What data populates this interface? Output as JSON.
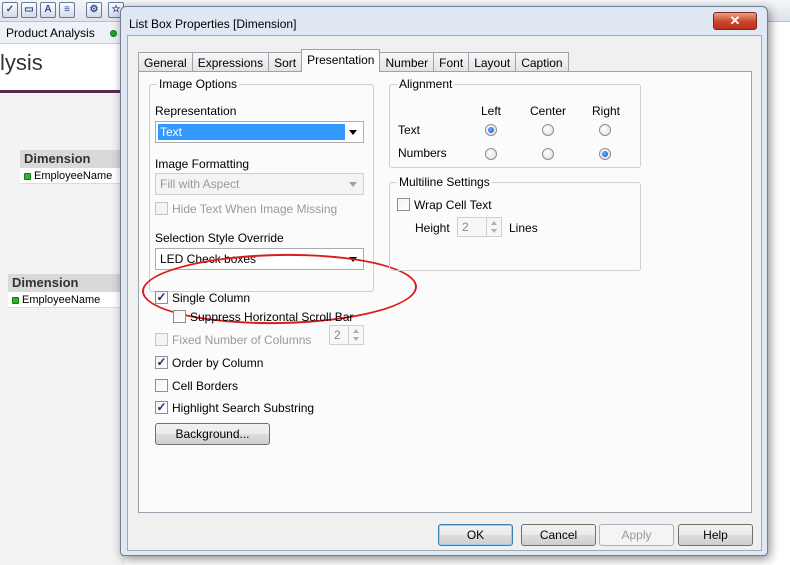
{
  "background_app": {
    "tab_label": "Product Analysis",
    "sheet_title": "lysis",
    "listbox_1": {
      "title": "Dimension",
      "item": "EmployeeName"
    },
    "listbox_2": {
      "title": "Dimension",
      "item": "EmployeeName"
    }
  },
  "dialog": {
    "title": "List Box Properties [Dimension]",
    "close_glyph": "✕",
    "tabs": [
      "General",
      "Expressions",
      "Sort",
      "Presentation",
      "Number",
      "Font",
      "Layout",
      "Caption"
    ],
    "active_tab": "Presentation"
  },
  "image_options": {
    "legend": "Image Options",
    "representation_label": "Representation",
    "representation_value": "Text",
    "image_formatting_label": "Image Formatting",
    "image_formatting_value": "Fill with Aspect",
    "hide_text_label": "Hide Text When Image Missing",
    "hide_text_checked": false,
    "selection_style_label": "Selection Style Override",
    "selection_style_value": "LED Check boxes"
  },
  "options": {
    "single_column": {
      "label": "Single Column",
      "checked": true
    },
    "suppress_scroll": {
      "label": "Suppress Horizontal Scroll Bar",
      "checked": false
    },
    "fixed_columns": {
      "label": "Fixed Number of Columns",
      "checked": false,
      "value": "2"
    },
    "order_by_column": {
      "label": "Order by Column",
      "checked": true
    },
    "cell_borders": {
      "label": "Cell Borders",
      "checked": false
    },
    "highlight_search": {
      "label": "Highlight Search Substring",
      "checked": true
    },
    "background_button": "Background..."
  },
  "alignment": {
    "legend": "Alignment",
    "columns": [
      "Left",
      "Center",
      "Right"
    ],
    "text_label": "Text",
    "text_selected": "Left",
    "numbers_label": "Numbers",
    "numbers_selected": "Right"
  },
  "multiline": {
    "legend": "Multiline Settings",
    "wrap_label": "Wrap Cell Text",
    "wrap_checked": false,
    "height_label": "Height",
    "height_value": "2",
    "lines_label": "Lines"
  },
  "footer": {
    "ok": "OK",
    "cancel": "Cancel",
    "apply": "Apply",
    "help": "Help"
  },
  "colors": {
    "accent_selection": "#3399ff",
    "annotation_red": "#d81c1c",
    "led_green": "#2cb52c"
  }
}
